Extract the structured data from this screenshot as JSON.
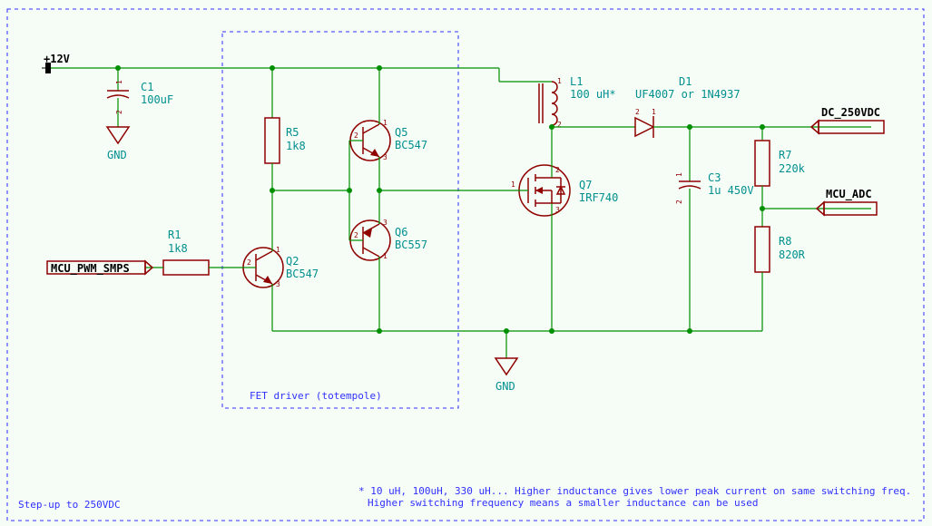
{
  "title": "Step-up to 250VDC",
  "subblock_label": "FET driver (totempole)",
  "nets": {
    "vin": "+12V",
    "gnd1": "GND",
    "gnd2": "GND",
    "pwm": "MCU_PWM_SMPS",
    "out": "DC_250VDC",
    "adc": "MCU_ADC"
  },
  "components": {
    "C1": {
      "ref": "C1",
      "val": "100uF"
    },
    "R1": {
      "ref": "R1",
      "val": "1k8"
    },
    "R5": {
      "ref": "R5",
      "val": "1k8"
    },
    "Q2": {
      "ref": "Q2",
      "val": "BC547"
    },
    "Q5": {
      "ref": "Q5",
      "val": "BC547"
    },
    "Q6": {
      "ref": "Q6",
      "val": "BC557"
    },
    "Q7": {
      "ref": "Q7",
      "val": "IRF740"
    },
    "L1": {
      "ref": "L1",
      "val": "100 uH*"
    },
    "D1": {
      "ref": "D1",
      "val": "UF4007 or 1N4937"
    },
    "C3": {
      "ref": "C3",
      "val": "1u 450V"
    },
    "R7": {
      "ref": "R7",
      "val": "220k"
    },
    "R8": {
      "ref": "R8",
      "val": "820R"
    }
  },
  "notes": {
    "line1": "* 10 uH, 100uH, 330 uH... Higher inductance gives lower peak current on same switching freq.",
    "line2": "Higher switching frequency means a smaller inductance can be used"
  },
  "chart_data": {
    "type": "table",
    "description": "Boost converter schematic components and connections",
    "components": [
      {
        "ref": "C1",
        "value": "100uF",
        "type": "capacitor_polarized",
        "nets": [
          "+12V",
          "GND"
        ]
      },
      {
        "ref": "R1",
        "value": "1k8",
        "type": "resistor",
        "nets": [
          "MCU_PWM_SMPS",
          "Q2.base"
        ]
      },
      {
        "ref": "R5",
        "value": "1k8",
        "type": "resistor",
        "nets": [
          "+12V",
          "Q2.collector"
        ]
      },
      {
        "ref": "Q2",
        "value": "BC547",
        "type": "npn",
        "nets": {
          "b": "R1",
          "c": "Q5.base/Q6.base",
          "e": "GND"
        }
      },
      {
        "ref": "Q5",
        "value": "BC547",
        "type": "npn",
        "nets": {
          "b": "drive",
          "c": "+12V",
          "e": "gate"
        }
      },
      {
        "ref": "Q6",
        "value": "BC557",
        "type": "pnp",
        "nets": {
          "b": "drive",
          "c": "GND",
          "e": "gate"
        }
      },
      {
        "ref": "Q7",
        "value": "IRF740",
        "type": "nmos",
        "nets": {
          "g": "gate",
          "d": "L1/D1",
          "s": "GND"
        }
      },
      {
        "ref": "L1",
        "value": "100 uH",
        "type": "inductor",
        "nets": [
          "+12V",
          "Q7.drain"
        ]
      },
      {
        "ref": "D1",
        "value": "UF4007 or 1N4937",
        "type": "diode",
        "nets": [
          "Q7.drain",
          "DC_250VDC"
        ]
      },
      {
        "ref": "C3",
        "value": "1u 450V",
        "type": "capacitor_polarized",
        "nets": [
          "DC_250VDC",
          "GND"
        ]
      },
      {
        "ref": "R7",
        "value": "220k",
        "type": "resistor",
        "nets": [
          "DC_250VDC",
          "MCU_ADC"
        ]
      },
      {
        "ref": "R8",
        "value": "820R",
        "type": "resistor",
        "nets": [
          "MCU_ADC",
          "GND"
        ]
      }
    ],
    "net_labels": [
      "+12V",
      "GND",
      "MCU_PWM_SMPS",
      "DC_250VDC",
      "MCU_ADC"
    ]
  }
}
